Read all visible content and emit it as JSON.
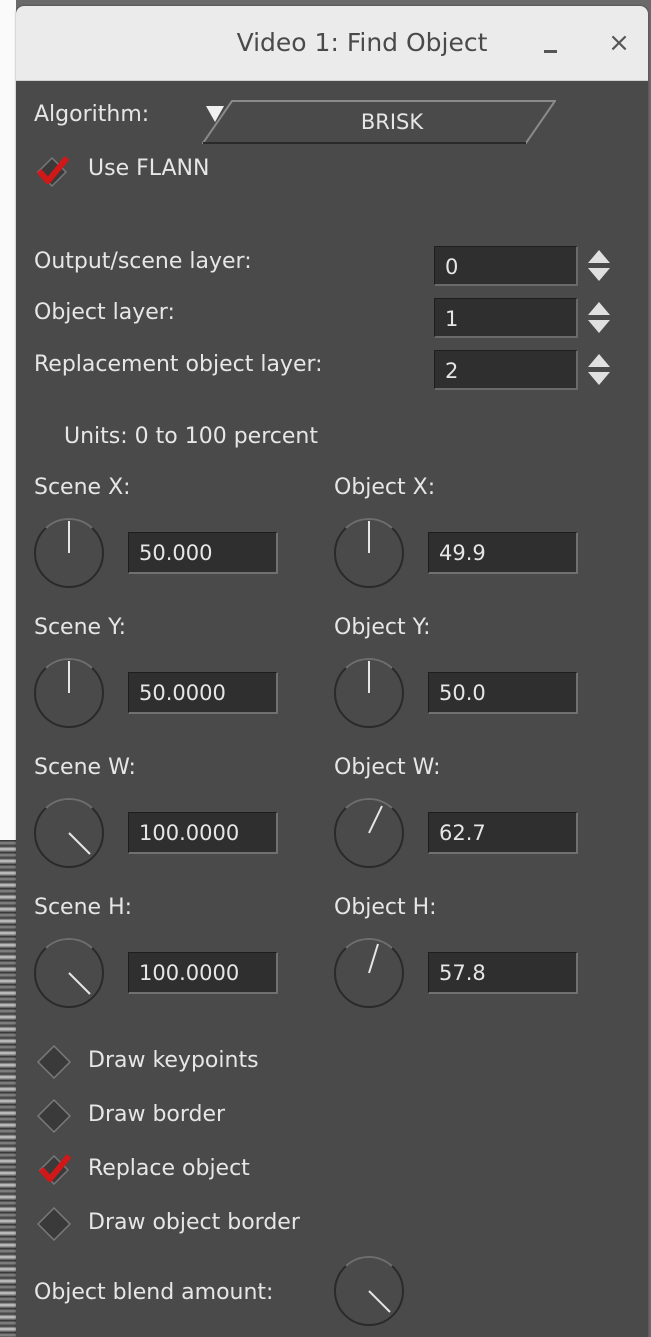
{
  "window": {
    "title": "Video 1: Find Object",
    "minimize_label": "_",
    "close_label": "×"
  },
  "algorithm": {
    "label": "Algorithm:",
    "selected": "BRISK"
  },
  "use_flann": {
    "label": "Use FLANN",
    "checked": true
  },
  "layers": [
    {
      "label": "Output/scene layer:",
      "value": "0"
    },
    {
      "label": "Object layer:",
      "value": "1"
    },
    {
      "label": "Replacement object layer:",
      "value": "2"
    }
  ],
  "units_note": "Units: 0 to 100 percent",
  "scene": [
    {
      "label": "Scene X:",
      "value": "50.000"
    },
    {
      "label": "Scene Y:",
      "value": "50.0000"
    },
    {
      "label": "Scene W:",
      "value": "100.0000"
    },
    {
      "label": "Scene H:",
      "value": "100.0000"
    }
  ],
  "object": [
    {
      "label": "Object X:",
      "value": "49.9"
    },
    {
      "label": "Object Y:",
      "value": "50.0"
    },
    {
      "label": "Object W:",
      "value": "62.7"
    },
    {
      "label": "Object H:",
      "value": "57.8"
    }
  ],
  "toggles": [
    {
      "label": "Draw keypoints",
      "checked": false
    },
    {
      "label": "Draw border",
      "checked": false
    },
    {
      "label": "Replace object",
      "checked": true
    },
    {
      "label": "Draw object border",
      "checked": false
    }
  ],
  "blend": {
    "label": "Object blend amount:"
  },
  "colors": {
    "panel_bg": "#4a4a4a",
    "titlebar_bg": "#ebebeb",
    "text": "#e6e6e6",
    "check_red": "#d01818",
    "field_bg": "#2f2f2f"
  }
}
